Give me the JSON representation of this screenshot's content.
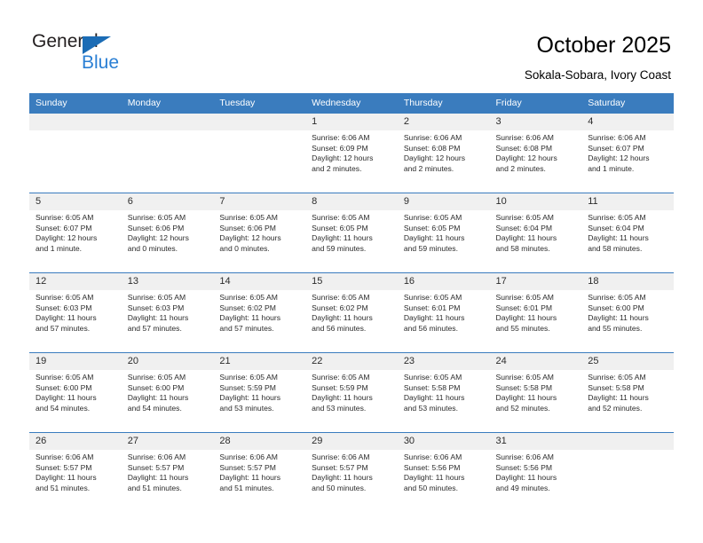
{
  "brand": {
    "name_part1": "General",
    "name_part2": "Blue",
    "triangle_icon": "triangle-icon",
    "accent_color": "#2a7fd4",
    "triangle_color": "#1b6cb5"
  },
  "header": {
    "title": "October 2025",
    "subtitle": "Sokala-Sobara, Ivory Coast"
  },
  "calendar": {
    "header_bg": "#3a7cbe",
    "daynum_bg": "#f0f0f0",
    "weekdays": [
      "Sunday",
      "Monday",
      "Tuesday",
      "Wednesday",
      "Thursday",
      "Friday",
      "Saturday"
    ],
    "weeks": [
      [
        {
          "day": "",
          "empty": true,
          "sunrise": "",
          "sunset": "",
          "daylight1": "",
          "daylight2": ""
        },
        {
          "day": "",
          "empty": true,
          "sunrise": "",
          "sunset": "",
          "daylight1": "",
          "daylight2": ""
        },
        {
          "day": "",
          "empty": true,
          "sunrise": "",
          "sunset": "",
          "daylight1": "",
          "daylight2": ""
        },
        {
          "day": "1",
          "empty": false,
          "sunrise": "Sunrise: 6:06 AM",
          "sunset": "Sunset: 6:09 PM",
          "daylight1": "Daylight: 12 hours",
          "daylight2": "and 2 minutes."
        },
        {
          "day": "2",
          "empty": false,
          "sunrise": "Sunrise: 6:06 AM",
          "sunset": "Sunset: 6:08 PM",
          "daylight1": "Daylight: 12 hours",
          "daylight2": "and 2 minutes."
        },
        {
          "day": "3",
          "empty": false,
          "sunrise": "Sunrise: 6:06 AM",
          "sunset": "Sunset: 6:08 PM",
          "daylight1": "Daylight: 12 hours",
          "daylight2": "and 2 minutes."
        },
        {
          "day": "4",
          "empty": false,
          "sunrise": "Sunrise: 6:06 AM",
          "sunset": "Sunset: 6:07 PM",
          "daylight1": "Daylight: 12 hours",
          "daylight2": "and 1 minute."
        }
      ],
      [
        {
          "day": "5",
          "empty": false,
          "sunrise": "Sunrise: 6:05 AM",
          "sunset": "Sunset: 6:07 PM",
          "daylight1": "Daylight: 12 hours",
          "daylight2": "and 1 minute."
        },
        {
          "day": "6",
          "empty": false,
          "sunrise": "Sunrise: 6:05 AM",
          "sunset": "Sunset: 6:06 PM",
          "daylight1": "Daylight: 12 hours",
          "daylight2": "and 0 minutes."
        },
        {
          "day": "7",
          "empty": false,
          "sunrise": "Sunrise: 6:05 AM",
          "sunset": "Sunset: 6:06 PM",
          "daylight1": "Daylight: 12 hours",
          "daylight2": "and 0 minutes."
        },
        {
          "day": "8",
          "empty": false,
          "sunrise": "Sunrise: 6:05 AM",
          "sunset": "Sunset: 6:05 PM",
          "daylight1": "Daylight: 11 hours",
          "daylight2": "and 59 minutes."
        },
        {
          "day": "9",
          "empty": false,
          "sunrise": "Sunrise: 6:05 AM",
          "sunset": "Sunset: 6:05 PM",
          "daylight1": "Daylight: 11 hours",
          "daylight2": "and 59 minutes."
        },
        {
          "day": "10",
          "empty": false,
          "sunrise": "Sunrise: 6:05 AM",
          "sunset": "Sunset: 6:04 PM",
          "daylight1": "Daylight: 11 hours",
          "daylight2": "and 58 minutes."
        },
        {
          "day": "11",
          "empty": false,
          "sunrise": "Sunrise: 6:05 AM",
          "sunset": "Sunset: 6:04 PM",
          "daylight1": "Daylight: 11 hours",
          "daylight2": "and 58 minutes."
        }
      ],
      [
        {
          "day": "12",
          "empty": false,
          "sunrise": "Sunrise: 6:05 AM",
          "sunset": "Sunset: 6:03 PM",
          "daylight1": "Daylight: 11 hours",
          "daylight2": "and 57 minutes."
        },
        {
          "day": "13",
          "empty": false,
          "sunrise": "Sunrise: 6:05 AM",
          "sunset": "Sunset: 6:03 PM",
          "daylight1": "Daylight: 11 hours",
          "daylight2": "and 57 minutes."
        },
        {
          "day": "14",
          "empty": false,
          "sunrise": "Sunrise: 6:05 AM",
          "sunset": "Sunset: 6:02 PM",
          "daylight1": "Daylight: 11 hours",
          "daylight2": "and 57 minutes."
        },
        {
          "day": "15",
          "empty": false,
          "sunrise": "Sunrise: 6:05 AM",
          "sunset": "Sunset: 6:02 PM",
          "daylight1": "Daylight: 11 hours",
          "daylight2": "and 56 minutes."
        },
        {
          "day": "16",
          "empty": false,
          "sunrise": "Sunrise: 6:05 AM",
          "sunset": "Sunset: 6:01 PM",
          "daylight1": "Daylight: 11 hours",
          "daylight2": "and 56 minutes."
        },
        {
          "day": "17",
          "empty": false,
          "sunrise": "Sunrise: 6:05 AM",
          "sunset": "Sunset: 6:01 PM",
          "daylight1": "Daylight: 11 hours",
          "daylight2": "and 55 minutes."
        },
        {
          "day": "18",
          "empty": false,
          "sunrise": "Sunrise: 6:05 AM",
          "sunset": "Sunset: 6:00 PM",
          "daylight1": "Daylight: 11 hours",
          "daylight2": "and 55 minutes."
        }
      ],
      [
        {
          "day": "19",
          "empty": false,
          "sunrise": "Sunrise: 6:05 AM",
          "sunset": "Sunset: 6:00 PM",
          "daylight1": "Daylight: 11 hours",
          "daylight2": "and 54 minutes."
        },
        {
          "day": "20",
          "empty": false,
          "sunrise": "Sunrise: 6:05 AM",
          "sunset": "Sunset: 6:00 PM",
          "daylight1": "Daylight: 11 hours",
          "daylight2": "and 54 minutes."
        },
        {
          "day": "21",
          "empty": false,
          "sunrise": "Sunrise: 6:05 AM",
          "sunset": "Sunset: 5:59 PM",
          "daylight1": "Daylight: 11 hours",
          "daylight2": "and 53 minutes."
        },
        {
          "day": "22",
          "empty": false,
          "sunrise": "Sunrise: 6:05 AM",
          "sunset": "Sunset: 5:59 PM",
          "daylight1": "Daylight: 11 hours",
          "daylight2": "and 53 minutes."
        },
        {
          "day": "23",
          "empty": false,
          "sunrise": "Sunrise: 6:05 AM",
          "sunset": "Sunset: 5:58 PM",
          "daylight1": "Daylight: 11 hours",
          "daylight2": "and 53 minutes."
        },
        {
          "day": "24",
          "empty": false,
          "sunrise": "Sunrise: 6:05 AM",
          "sunset": "Sunset: 5:58 PM",
          "daylight1": "Daylight: 11 hours",
          "daylight2": "and 52 minutes."
        },
        {
          "day": "25",
          "empty": false,
          "sunrise": "Sunrise: 6:05 AM",
          "sunset": "Sunset: 5:58 PM",
          "daylight1": "Daylight: 11 hours",
          "daylight2": "and 52 minutes."
        }
      ],
      [
        {
          "day": "26",
          "empty": false,
          "sunrise": "Sunrise: 6:06 AM",
          "sunset": "Sunset: 5:57 PM",
          "daylight1": "Daylight: 11 hours",
          "daylight2": "and 51 minutes."
        },
        {
          "day": "27",
          "empty": false,
          "sunrise": "Sunrise: 6:06 AM",
          "sunset": "Sunset: 5:57 PM",
          "daylight1": "Daylight: 11 hours",
          "daylight2": "and 51 minutes."
        },
        {
          "day": "28",
          "empty": false,
          "sunrise": "Sunrise: 6:06 AM",
          "sunset": "Sunset: 5:57 PM",
          "daylight1": "Daylight: 11 hours",
          "daylight2": "and 51 minutes."
        },
        {
          "day": "29",
          "empty": false,
          "sunrise": "Sunrise: 6:06 AM",
          "sunset": "Sunset: 5:57 PM",
          "daylight1": "Daylight: 11 hours",
          "daylight2": "and 50 minutes."
        },
        {
          "day": "30",
          "empty": false,
          "sunrise": "Sunrise: 6:06 AM",
          "sunset": "Sunset: 5:56 PM",
          "daylight1": "Daylight: 11 hours",
          "daylight2": "and 50 minutes."
        },
        {
          "day": "31",
          "empty": false,
          "sunrise": "Sunrise: 6:06 AM",
          "sunset": "Sunset: 5:56 PM",
          "daylight1": "Daylight: 11 hours",
          "daylight2": "and 49 minutes."
        },
        {
          "day": "",
          "empty": true,
          "sunrise": "",
          "sunset": "",
          "daylight1": "",
          "daylight2": ""
        }
      ]
    ]
  }
}
